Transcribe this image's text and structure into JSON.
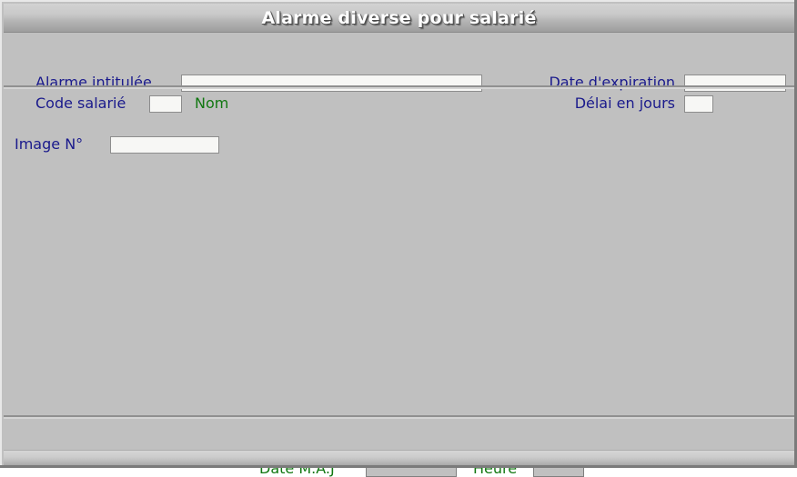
{
  "window": {
    "title": "Alarme diverse pour salarié",
    "accent_label_color": "#1a1a8c",
    "accent_green_color": "#117711",
    "background_color": "#c0c0c0",
    "field_background_color": "#f7f7f5"
  },
  "header": {
    "fields": {
      "alarme_intitulee": {
        "label": "Alarme intitulée",
        "value": "",
        "placeholder": ""
      },
      "code_salarie": {
        "label": "Code salarié",
        "value": "",
        "placeholder": ""
      },
      "nom": {
        "label": "Nom",
        "value": ""
      },
      "date_expiration": {
        "label": "Date d'expiration",
        "value": "",
        "placeholder": ""
      },
      "delai_en_jours": {
        "label": "Délai en jours",
        "value": "",
        "placeholder": ""
      }
    }
  },
  "main": {
    "fields": {
      "image_numero": {
        "label": "Image N°",
        "value": "",
        "placeholder": ""
      }
    }
  },
  "footer": {
    "fields": {
      "date_maj": {
        "label": "Date M.A.J",
        "value": "",
        "placeholder": ""
      },
      "heure": {
        "label": "Heure",
        "value": "",
        "placeholder": ""
      }
    }
  }
}
